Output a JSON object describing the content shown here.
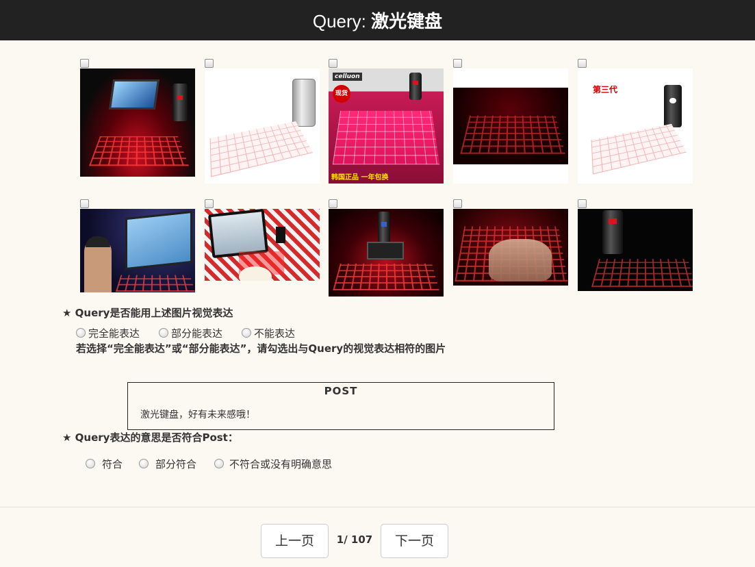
{
  "header": {
    "prefix": "Query: ",
    "query": "激光键盘"
  },
  "images": [
    {
      "label": "image-1"
    },
    {
      "label": "image-2"
    },
    {
      "label": "image-3",
      "brand": "celluon",
      "badge": "现货",
      "caption": "韩国正品 一年包换"
    },
    {
      "label": "image-4"
    },
    {
      "label": "image-5",
      "tag": "第三代"
    },
    {
      "label": "image-6"
    },
    {
      "label": "image-7"
    },
    {
      "label": "image-8"
    },
    {
      "label": "image-9"
    },
    {
      "label": "image-10"
    }
  ],
  "q1": {
    "title": "★ Query是否能用上述图片视觉表达",
    "options": [
      "完全能表达",
      "部分能表达",
      "不能表达"
    ],
    "hint": "若选择“完全能表达”或“部分能表达”，请勾选出与Query的视觉表达相符的图片"
  },
  "post": {
    "title": "POST",
    "text": "激光键盘，好有未来感哦！"
  },
  "q2": {
    "title": "★ Query表达的意思是否符合Post：",
    "options": [
      "符合",
      "部分符合",
      "不符合或没有明确意思"
    ]
  },
  "pagination": {
    "prev": "上一页",
    "current": "1",
    "total": "/ 107",
    "next": "下一页"
  },
  "colors": {
    "header_bg": "#222222",
    "page_bg": "#fcf9f3",
    "laser_red": "#e01020",
    "pink": "#ff2a7a"
  }
}
